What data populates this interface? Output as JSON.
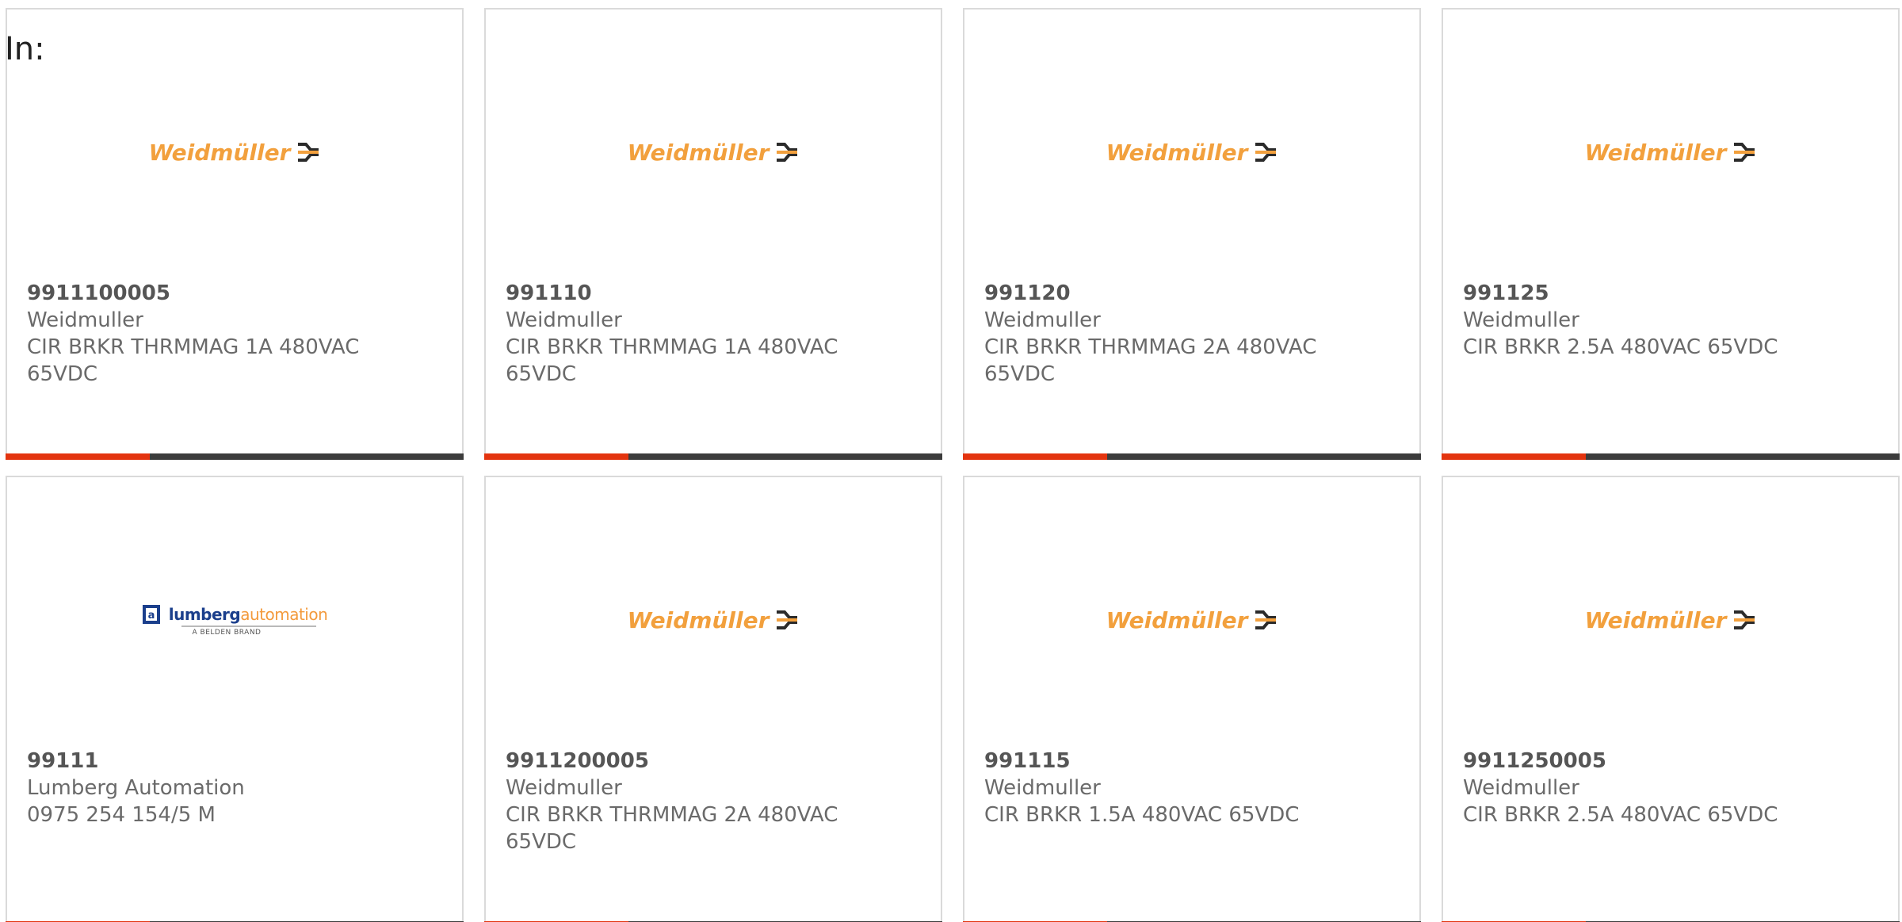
{
  "header": {
    "label": "In:"
  },
  "colors": {
    "accent": "#e3340f",
    "bar": "#3c3c3c",
    "weidmuller_orange": "#f2a03d",
    "lumberg_blue": "#1b3f8c",
    "lumberg_orange": "#f39a3c"
  },
  "products": [
    {
      "part": "9911100005",
      "manufacturer": "Weidmuller",
      "description": "CIR BRKR THRMMAG 1A 480VAC 65VDC",
      "logo": "weidmuller-logo"
    },
    {
      "part": "991110",
      "manufacturer": "Weidmuller",
      "description": "CIR BRKR THRMMAG 1A 480VAC 65VDC",
      "logo": "weidmuller-logo"
    },
    {
      "part": "991120",
      "manufacturer": "Weidmuller",
      "description": "CIR BRKR THRMMAG 2A 480VAC 65VDC",
      "logo": "weidmuller-logo"
    },
    {
      "part": "991125",
      "manufacturer": "Weidmuller",
      "description": "CIR BRKR 2.5A 480VAC 65VDC",
      "logo": "weidmuller-logo"
    },
    {
      "part": "99111",
      "manufacturer": "Lumberg Automation",
      "description": "0975 254 154/5 M",
      "logo": "lumberg-automation-logo"
    },
    {
      "part": "9911200005",
      "manufacturer": "Weidmuller",
      "description": "CIR BRKR THRMMAG 2A 480VAC 65VDC",
      "logo": "weidmuller-logo"
    },
    {
      "part": "991115",
      "manufacturer": "Weidmuller",
      "description": "CIR BRKR 1.5A 480VAC 65VDC",
      "logo": "weidmuller-logo"
    },
    {
      "part": "9911250005",
      "manufacturer": "Weidmuller",
      "description": "CIR BRKR 2.5A 480VAC 65VDC",
      "logo": "weidmuller-logo"
    }
  ],
  "logos": {
    "weidmuller": {
      "text": "Weidmüller"
    },
    "lumberg": {
      "word_a": "lumberg",
      "word_b": "automation",
      "sub": "A BELDEN BRAND"
    }
  }
}
